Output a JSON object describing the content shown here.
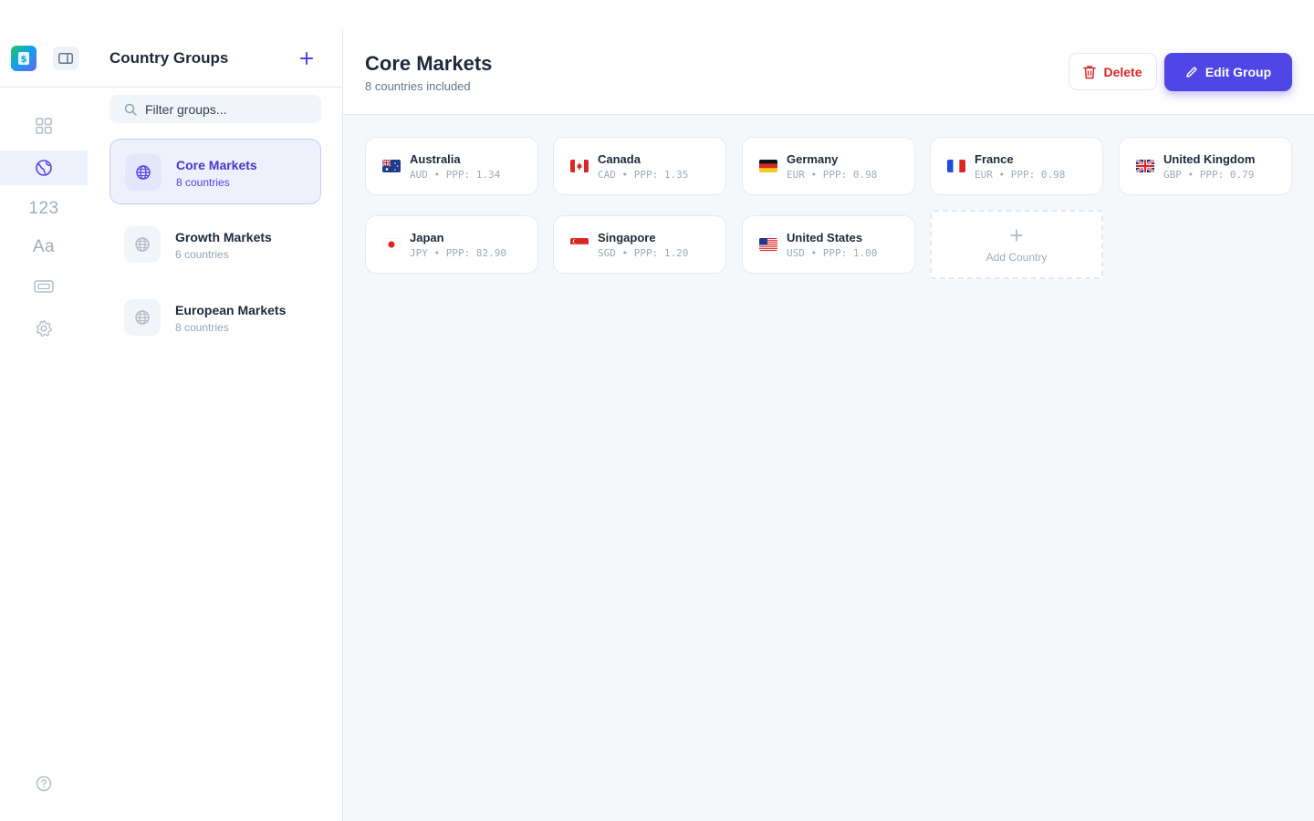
{
  "rail": {
    "logo_icon": "app-logo-icon",
    "toggle_icon": "sidebar-toggle-icon",
    "items": [
      {
        "icon": "grid-icon",
        "label": ""
      },
      {
        "icon": "globe-icon",
        "label": "",
        "active": true
      },
      {
        "icon": "numbers-icon",
        "label": "123"
      },
      {
        "icon": "typography-icon",
        "label": "Aa"
      },
      {
        "icon": "ticket-icon",
        "label": ""
      },
      {
        "icon": "gear-icon",
        "label": ""
      }
    ],
    "help_icon": "help-icon"
  },
  "groups_panel": {
    "title": "Country Groups",
    "add_icon": "plus-icon",
    "search_placeholder": "Filter groups...",
    "groups": [
      {
        "name": "Core Markets",
        "count": "8 countries",
        "active": true
      },
      {
        "name": "Growth Markets",
        "count": "6 countries",
        "active": false
      },
      {
        "name": "European Markets",
        "count": "8 countries",
        "active": false
      }
    ]
  },
  "main": {
    "title": "Core Markets",
    "subtitle": "8 countries included",
    "delete_label": "Delete",
    "edit_label": "Edit Group",
    "countries": [
      {
        "name": "Australia",
        "meta": "AUD • PPP: 1.34",
        "flag": "au"
      },
      {
        "name": "Canada",
        "meta": "CAD • PPP: 1.35",
        "flag": "ca"
      },
      {
        "name": "Germany",
        "meta": "EUR • PPP: 0.98",
        "flag": "de"
      },
      {
        "name": "France",
        "meta": "EUR • PPP: 0.98",
        "flag": "fr"
      },
      {
        "name": "United Kingdom",
        "meta": "GBP • PPP: 0.79",
        "flag": "gb"
      },
      {
        "name": "Japan",
        "meta": "JPY • PPP: 82.90",
        "flag": "jp"
      },
      {
        "name": "Singapore",
        "meta": "SGD • PPP: 1.20",
        "flag": "sg"
      },
      {
        "name": "United States",
        "meta": "USD • PPP: 1.00",
        "flag": "us"
      }
    ],
    "add_country_label": "Add Country"
  },
  "colors": {
    "accent": "#4f46e5",
    "danger": "#dc2626",
    "background": "#f5f8fb"
  }
}
